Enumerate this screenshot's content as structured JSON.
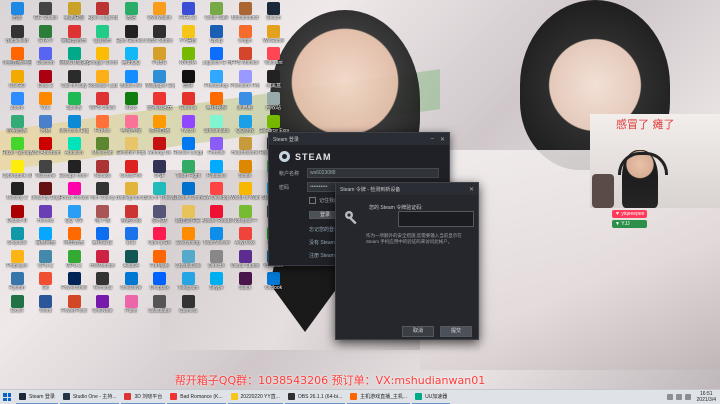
{
  "desktop_icons": [
    {
      "label": "迅雷",
      "color": "#1e88e5"
    },
    {
      "label": "GG Studio",
      "color": "#444"
    },
    {
      "label": "英雄联盟",
      "color": "#c9a227"
    },
    {
      "label": "Apex Legends",
      "color": "#b33"
    },
    {
      "label": "微信",
      "color": "#2aae67"
    },
    {
      "label": "Overwatch",
      "color": "#f99e1a"
    },
    {
      "label": "FIFA 21",
      "color": "#3a4fd6"
    },
    {
      "label": "Color Sale",
      "color": "#7a4"
    },
    {
      "label": "Bloodhound",
      "color": "#a63"
    },
    {
      "label": "Steam",
      "color": "#1b2838"
    },
    {
      "label": "Battlefield",
      "color": "#333"
    },
    {
      "label": "GTA V",
      "color": "#2d7d3a"
    },
    {
      "label": "网易云音乐",
      "color": "#d33"
    },
    {
      "label": "QQ音乐",
      "color": "#2c8"
    },
    {
      "label": "Epic Games Launcher",
      "color": "#222"
    },
    {
      "label": "OBS Studio",
      "color": "#302e31"
    },
    {
      "label": "YY语音",
      "color": "#f5c518"
    },
    {
      "label": "Uplay",
      "color": "#1a5fb4"
    },
    {
      "label": "Origin",
      "color": "#f56c2d"
    },
    {
      "label": "WeGame",
      "color": "#e4a11b"
    },
    {
      "label": "斗鱼直播伴侣",
      "color": "#f60"
    },
    {
      "label": "Discord",
      "color": "#5865f2"
    },
    {
      "label": "网易UU加速器",
      "color": "#0a8"
    },
    {
      "label": "Google Chrome",
      "color": "#fbbc05"
    },
    {
      "label": "腾讯QQ",
      "color": "#12b7f5"
    },
    {
      "label": "PUBG",
      "color": "#d59f2c"
    },
    {
      "label": "NVIDIA",
      "color": "#76b900"
    },
    {
      "label": "Logitech G HUB",
      "color": "#0d6efd"
    },
    {
      "label": "FPS Monitor",
      "color": "#d4452b"
    },
    {
      "label": "Valorant",
      "color": "#ff4655"
    },
    {
      "label": "CS:GO",
      "color": "#f2a900"
    },
    {
      "label": "Dota 2",
      "color": "#a01"
    },
    {
      "label": "Call of Duty",
      "color": "#2b2b2b"
    },
    {
      "label": "Rockstar Launcher",
      "color": "#fcaf17"
    },
    {
      "label": "Battle.net",
      "color": "#148eff"
    },
    {
      "label": "Wallpaper Engine",
      "color": "#2f8fd6"
    },
    {
      "label": "剪映",
      "color": "#111"
    },
    {
      "label": "Photoshop",
      "color": "#31a8ff"
    },
    {
      "label": "Premiere Pro",
      "color": "#9999ff"
    },
    {
      "label": "小黑盒",
      "color": "#222"
    },
    {
      "label": "Zoom",
      "color": "#2d8cff"
    },
    {
      "label": "VLC",
      "color": "#f80"
    },
    {
      "label": "Spotify",
      "color": "#1db954"
    },
    {
      "label": "WPS Office",
      "color": "#d33"
    },
    {
      "label": "Xbox",
      "color": "#107c10"
    },
    {
      "label": "雷神加速器",
      "color": "#e33"
    },
    {
      "label": "Garena",
      "color": "#e4322b"
    },
    {
      "label": "腾讯视频",
      "color": "#ff6a00"
    },
    {
      "label": "此电脑",
      "color": "#3a8ee6"
    },
    {
      "label": "回收站",
      "color": "#9aa"
    },
    {
      "label": "控制面板",
      "color": "#3a7"
    },
    {
      "label": "网络",
      "color": "#4a7fc9"
    },
    {
      "label": "Microsoft Edge",
      "color": "#0c8ad6"
    },
    {
      "label": "Firefox",
      "color": "#ff7139"
    },
    {
      "label": "哔哩哔哩",
      "color": "#fb7299"
    },
    {
      "label": "虎牙直播",
      "color": "#f90"
    },
    {
      "label": "Twitch",
      "color": "#9146ff"
    },
    {
      "label": "Streamlabs",
      "color": "#80f5d2"
    },
    {
      "label": "QQ游戏",
      "color": "#1aa0e8"
    },
    {
      "label": "GeForce Experience",
      "color": "#76b900"
    },
    {
      "label": "Razer Synapse",
      "color": "#44d62c"
    },
    {
      "label": "MSI Afterburner",
      "color": "#c00"
    },
    {
      "label": "Audition",
      "color": "#00e4bb"
    },
    {
      "label": "Minecraft",
      "color": "#5b8731"
    },
    {
      "label": "Genshin Impact",
      "color": "#e8c46a"
    },
    {
      "label": "Among Us",
      "color": "#c51111"
    },
    {
      "label": "Rocket League",
      "color": "#0078f2"
    },
    {
      "label": "Fortnite",
      "color": "#8b5cf6"
    },
    {
      "label": "Hearthstone",
      "color": "#c79b3b"
    },
    {
      "label": "Rainbow Six",
      "color": "#333"
    },
    {
      "label": "Cyberpunk 2077",
      "color": "#fcee0a"
    },
    {
      "label": "Warzone",
      "color": "#444"
    },
    {
      "label": "Escape from Tarkov",
      "color": "#222"
    },
    {
      "label": "Naraka",
      "color": "#a33"
    },
    {
      "label": "CrossFire",
      "color": "#d22"
    },
    {
      "label": "DNF",
      "color": "#335"
    },
    {
      "label": "Team Fight",
      "color": "#3a6"
    },
    {
      "label": "Paladins",
      "color": "#0af"
    },
    {
      "label": "Smite",
      "color": "#d80"
    },
    {
      "label": "Halo",
      "color": "#3b5"
    },
    {
      "label": "Destiny 2",
      "color": "#222"
    },
    {
      "label": "Dead by Daylight",
      "color": "#611"
    },
    {
      "label": "Forza Horizon",
      "color": "#f0a"
    },
    {
      "label": "Tom Clancy",
      "color": "#333"
    },
    {
      "label": "Battlegrounds",
      "color": "#e2b43c"
    },
    {
      "label": "Sea of Thieves",
      "color": "#2bb"
    },
    {
      "label": "Ubisoft Connect",
      "color": "#0071ce"
    },
    {
      "label": "EA Desktop",
      "color": "#f44"
    },
    {
      "label": "World of Warcraft",
      "color": "#f8b700"
    },
    {
      "label": "StarCraft II",
      "color": "#00aeff"
    },
    {
      "label": "Diablo III",
      "color": "#a00"
    },
    {
      "label": "Heroes",
      "color": "#6a3fb5"
    },
    {
      "label": "QQ飞车",
      "color": "#2a9df4"
    },
    {
      "label": "地下城",
      "color": "#a55"
    },
    {
      "label": "穿越火线",
      "color": "#c33"
    },
    {
      "label": "逆水寒",
      "color": "#557"
    },
    {
      "label": "新建文件夹",
      "color": "#e8c25a"
    },
    {
      "label": "Adobe Reader",
      "color": "#e13"
    },
    {
      "label": "Notepad++",
      "color": "#7b3"
    },
    {
      "label": "7-Zip",
      "color": "#444"
    },
    {
      "label": "Snipaste",
      "color": "#19a"
    },
    {
      "label": "百度网盘",
      "color": "#06a7ff"
    },
    {
      "label": "阿里云盘",
      "color": "#ff6a00"
    },
    {
      "label": "腾讯会议",
      "color": "#0d6ef0"
    },
    {
      "label": "钉钉",
      "color": "#1a73e8"
    },
    {
      "label": "Opera GX",
      "color": "#fe1a4f"
    },
    {
      "label": "Everything",
      "color": "#ff8c00"
    },
    {
      "label": "TeamViewer",
      "color": "#0e8ee9"
    },
    {
      "label": "AnyDesk",
      "color": "#ef443b"
    },
    {
      "label": "iQIYI",
      "color": "#00be06"
    },
    {
      "label": "Potplayer",
      "color": "#fcb514"
    },
    {
      "label": "CPU-Z",
      "color": "#48a"
    },
    {
      "label": "GPU-Z",
      "color": "#3a3"
    },
    {
      "label": "HWMonitor",
      "color": "#c24"
    },
    {
      "label": "Aida64",
      "color": "#155"
    },
    {
      "label": "FurMark",
      "color": "#f60"
    },
    {
      "label": "CrystalDisk",
      "color": "#5ac"
    },
    {
      "label": "DirectX",
      "color": "#888"
    },
    {
      "label": "Visual Studio",
      "color": "#5c2d91"
    },
    {
      "label": "VS Code",
      "color": "#007acc"
    },
    {
      "label": "Python",
      "color": "#3776ab"
    },
    {
      "label": "Git",
      "color": "#f05032"
    },
    {
      "label": "PowerShell",
      "color": "#012456"
    },
    {
      "label": "Terminal",
      "color": "#333"
    },
    {
      "label": "OneDrive",
      "color": "#0078d4"
    },
    {
      "label": "Dropbox",
      "color": "#0061ff"
    },
    {
      "label": "Telegram",
      "color": "#26a5e4"
    },
    {
      "label": "Skype",
      "color": "#00aff0"
    },
    {
      "label": "Slack",
      "color": "#4a154b"
    },
    {
      "label": "Outlook",
      "color": "#0078d4"
    },
    {
      "label": "Excel",
      "color": "#217346"
    },
    {
      "label": "Word",
      "color": "#2b579a"
    },
    {
      "label": "PowerPoint",
      "color": "#d24726"
    },
    {
      "label": "OneNote",
      "color": "#7719aa"
    },
    {
      "label": "Paint",
      "color": "#e6a"
    },
    {
      "label": "Calculator",
      "color": "#555"
    },
    {
      "label": "Camera",
      "color": "#333"
    }
  ],
  "steam_login": {
    "title": "Steam 登录",
    "logo_text": "STEAM",
    "username_label": "帐户名称",
    "username_value": "ws6023088",
    "password_label": "密码",
    "password_value": "••••••••••",
    "remember_label": "记住我的密码",
    "login_button": "登录",
    "no_account_label": "没有 Steam 帐户?",
    "forgot_label": "忘记您的登录信息",
    "create_label": "注册 Steam 新帐户"
  },
  "steam_guard": {
    "title": "Steam 令牌 - 检测到新设备",
    "prompt": "您的 Steam 令牌验证码:",
    "code_value": "",
    "description": "作为一项额外的安全措施,您需要输入当前显示在 Steam 手机应用中的验证码来访问此帐户。",
    "cancel_button": "取消",
    "submit_button": "提交"
  },
  "webcam": {
    "caption": "感冒了 瘫了"
  },
  "tags": [
    {
      "text": "▼ yiqeeepee",
      "color": "#ff3a5a"
    },
    {
      "text": "▼ YJJ",
      "color": "#2c8f4a"
    }
  ],
  "banner": {
    "text": "帮开箱子QQ群：1038543206 预订单：VX:mshudianwan01"
  },
  "taskbar": {
    "items": [
      {
        "label": "Steam 登录",
        "color": "#1b2838"
      },
      {
        "label": "Studio One - 主持...",
        "color": "#234"
      },
      {
        "label": "3D 刘晓平台",
        "color": "#d33"
      },
      {
        "label": "Bad Romance (K...",
        "color": "#e33"
      },
      {
        "label": "20220220 YY直...",
        "color": "#f5c518"
      },
      {
        "label": "OBS 26.1.1 (64-bi...",
        "color": "#302e31"
      },
      {
        "label": "主机游戏直播_主机...",
        "color": "#f60"
      },
      {
        "label": "UU加速器",
        "color": "#0a8"
      }
    ],
    "time": "16:51",
    "date": "2021/3/4"
  }
}
